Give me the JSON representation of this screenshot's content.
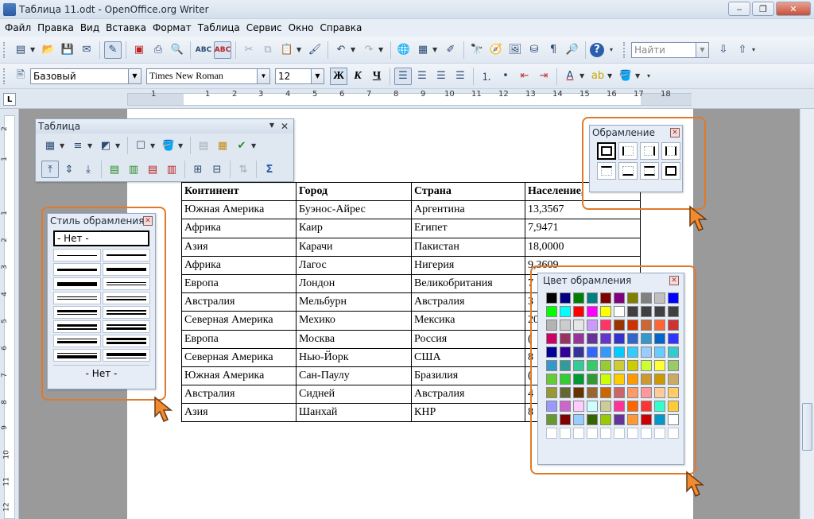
{
  "window": {
    "title": "Таблица 11.odt - OpenOffice.org Writer",
    "min": "‒",
    "max": "❐",
    "close": "✕"
  },
  "menu": [
    "Файл",
    "Правка",
    "Вид",
    "Вставка",
    "Формат",
    "Таблица",
    "Сервис",
    "Окно",
    "Справка"
  ],
  "format_bar": {
    "style": "Базовый",
    "font": "Times New Roman",
    "size": "12",
    "bold": "Ж",
    "italic": "К",
    "underline": "Ч"
  },
  "find": {
    "placeholder": "Найти"
  },
  "ruler": {
    "corner": "L",
    "numbers": [
      "1",
      "1",
      "2",
      "3",
      "4",
      "5",
      "6",
      "7",
      "8",
      "9",
      "10",
      "11",
      "12",
      "13",
      "14",
      "15",
      "16",
      "17",
      "18"
    ],
    "vnumbers": [
      "2",
      "1",
      "1",
      "2",
      "3",
      "4",
      "5",
      "6",
      "7",
      "8",
      "9",
      "10",
      "11",
      "12"
    ]
  },
  "table_toolbar": {
    "title": "Таблица"
  },
  "borders_panel": {
    "title": "Обрамление"
  },
  "style_panel": {
    "title": "Стиль обрамления",
    "none_top": "- Нет -",
    "none_bottom": "- Нет -"
  },
  "color_panel": {
    "title": "Цвет обрамления"
  },
  "colors": [
    "#000000",
    "#000080",
    "#008000",
    "#008080",
    "#800000",
    "#800080",
    "#808000",
    "#808080",
    "#c0c0c0",
    "#0000ff",
    "#00ff00",
    "#00ffff",
    "#ff0000",
    "#ff00ff",
    "#ffff00",
    "#ffffff",
    "#404040",
    "#404040",
    "#404040",
    "#404040",
    "#b3b3b3",
    "#cccccc",
    "#e6e6e6",
    "#cc99ff",
    "#ff3366",
    "#993300",
    "#cc3300",
    "#cc6633",
    "#ff6633",
    "#cc3333",
    "#cc0066",
    "#993366",
    "#993399",
    "#663399",
    "#6633cc",
    "#3333cc",
    "#3366cc",
    "#3399cc",
    "#0066cc",
    "#3333ff",
    "#000099",
    "#330099",
    "#333399",
    "#3366ff",
    "#3399ff",
    "#00ccff",
    "#33ccff",
    "#99ccff",
    "#66ccff",
    "#33cccc",
    "#3399cc",
    "#339999",
    "#33cc99",
    "#33cc66",
    "#99cc33",
    "#cccc33",
    "#cccc00",
    "#ccff33",
    "#ffff33",
    "#99cc66",
    "#66cc33",
    "#33cc33",
    "#009933",
    "#339933",
    "#ccff00",
    "#ffcc00",
    "#ff9900",
    "#cc9933",
    "#cc9900",
    "#ccaa66",
    "#999933",
    "#666633",
    "#663300",
    "#996633",
    "#cc6600",
    "#cc6666",
    "#ff9966",
    "#ff9999",
    "#ffcc99",
    "#ffcc66",
    "#9999ff",
    "#cc66cc",
    "#ffccff",
    "#ccffff",
    "#cccc99",
    "#ff3399",
    "#ff6600",
    "#ff3333",
    "#33ffcc",
    "#ffcc33",
    "#669933",
    "#800000",
    "#99ccff",
    "#336600",
    "#99cc00",
    "#663399",
    "#ff9933",
    "#cc0000",
    "#0099cc",
    "#ffffff",
    "empty",
    "empty",
    "empty",
    "empty",
    "empty",
    "empty",
    "empty",
    "empty",
    "empty",
    "empty"
  ],
  "doc_table": {
    "headers": [
      "Континент",
      "Город",
      "Страна",
      "Население,"
    ],
    "rows": [
      [
        "Южная Америка",
        "Буэнос-Айрес",
        "Аргентина",
        "13,3567"
      ],
      [
        "Африка",
        "Каир",
        "Египет",
        "7,9471"
      ],
      [
        "Азия",
        "Карачи",
        "Пакистан",
        "18,0000"
      ],
      [
        "Африка",
        "Лагос",
        "Нигерия",
        "9,3609"
      ],
      [
        "Европа",
        "Лондон",
        "Великобритания",
        "7"
      ],
      [
        "Австралия",
        "Мельбурн",
        "Австралия",
        "3"
      ],
      [
        "Северная Америка",
        "Мехико",
        "Мексика",
        "20"
      ],
      [
        "Европа",
        "Москва",
        "Россия",
        "("
      ],
      [
        "Северная Америка",
        "Нью-Йорк",
        "США",
        "8"
      ],
      [
        "Южная Америка",
        "Сан-Паулу",
        "Бразилия",
        "("
      ],
      [
        "Австралия",
        "Сидней",
        "Австралия",
        "4"
      ],
      [
        "Азия",
        "Шанхай",
        "КНР",
        "8"
      ]
    ]
  }
}
